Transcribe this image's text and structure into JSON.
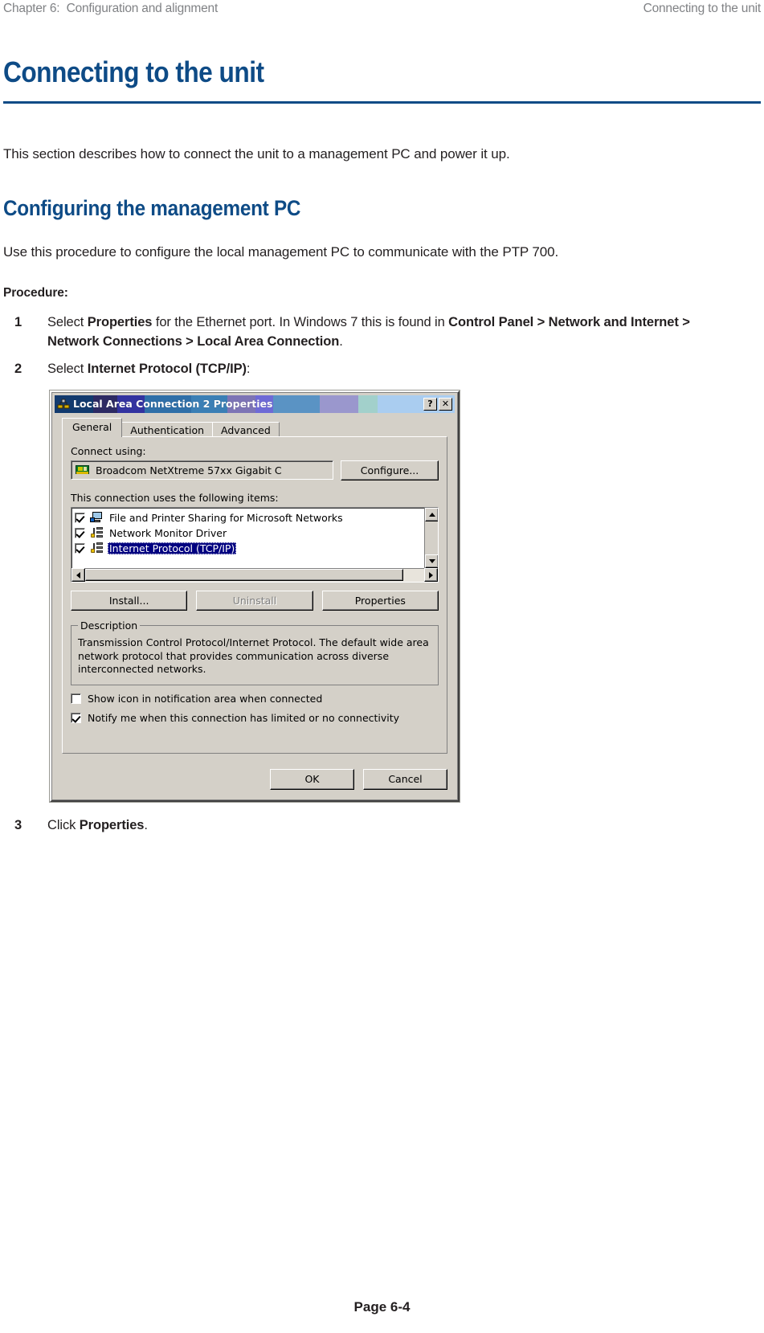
{
  "header": {
    "left": "Chapter 6:  Configuration and alignment",
    "right": "Connecting to the unit"
  },
  "doc": {
    "chapter_title": "Connecting to the unit",
    "intro": "This section describes how to connect the unit to a management PC and power it up.",
    "section_title": "Configuring the management PC",
    "section_intro": "Use this procedure to configure the local management PC to communicate with the PTP 700.",
    "procedure_label": "Procedure:",
    "steps": [
      {
        "num": "1",
        "parts": [
          {
            "text": "Select ",
            "bold": false
          },
          {
            "text": "Properties",
            "bold": true
          },
          {
            "text": " for the Ethernet port. In Windows 7 this is found in ",
            "bold": false
          },
          {
            "text": "Control Panel > Network and Internet > Network Connections > Local Area Connection",
            "bold": true
          },
          {
            "text": ".",
            "bold": false
          }
        ]
      },
      {
        "num": "2",
        "parts": [
          {
            "text": "Select ",
            "bold": false
          },
          {
            "text": "Internet Protocol (TCP/IP)",
            "bold": true
          },
          {
            "text": ":",
            "bold": false
          }
        ]
      },
      {
        "num": "3",
        "parts": [
          {
            "text": "Click ",
            "bold": false
          },
          {
            "text": "Properties",
            "bold": true
          },
          {
            "text": ".",
            "bold": false
          }
        ]
      }
    ]
  },
  "dialog": {
    "title": "Local Area Connection 2 Properties",
    "title_icon": "network-connection-icon",
    "help_button": "?",
    "close_button": "✕",
    "tabs": [
      {
        "label": "General",
        "active": true
      },
      {
        "label": "Authentication",
        "active": false
      },
      {
        "label": "Advanced",
        "active": false
      }
    ],
    "connect_using_label": "Connect using:",
    "adapter": {
      "name": "Broadcom NetXtreme 57xx Gigabit C",
      "icon": "network-adapter-icon"
    },
    "configure_button": "Configure...",
    "items_label": "This connection uses the following items:",
    "items": [
      {
        "label": "File and Printer Sharing for Microsoft Networks",
        "checked": true,
        "selected": false,
        "icon": "file-printer-sharing-icon"
      },
      {
        "label": "Network Monitor Driver",
        "checked": true,
        "selected": false,
        "icon": "protocol-icon"
      },
      {
        "label": "Internet Protocol (TCP/IP)",
        "checked": true,
        "selected": true,
        "icon": "protocol-icon"
      }
    ],
    "buttons": {
      "install": "Install...",
      "uninstall": "Uninstall",
      "uninstall_disabled": true,
      "properties": "Properties"
    },
    "description": {
      "legend": "Description",
      "text": "Transmission Control Protocol/Internet Protocol. The default wide area network protocol that provides communication across diverse interconnected networks."
    },
    "options": [
      {
        "label": "Show icon in notification area when connected",
        "checked": false
      },
      {
        "label": "Notify me when this connection has limited or no connectivity",
        "checked": true
      }
    ],
    "footer_buttons": {
      "ok": "OK",
      "cancel": "Cancel"
    }
  },
  "footer": {
    "page_number": "Page 6-4"
  },
  "colors": {
    "heading_blue": "#0e4b86",
    "body_text": "#231f20",
    "header_grey": "#808285",
    "dialog_face": "#d4d0c8",
    "selection_blue": "#000080"
  }
}
